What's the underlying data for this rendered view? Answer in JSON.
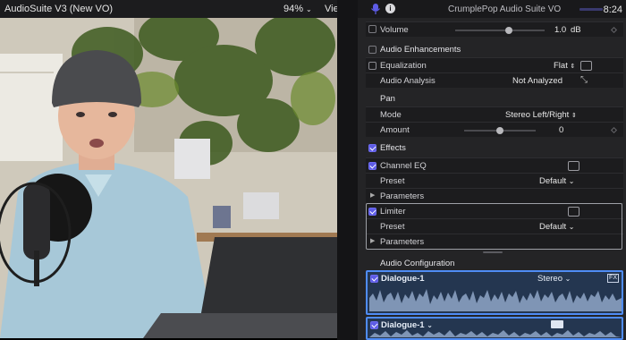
{
  "viewer": {
    "title": "AudioSuite V3 (New VO)",
    "zoom": "94%",
    "view_label": "View"
  },
  "inspector": {
    "title": "CrumplePop Audio Suite VO",
    "timecode": "8:24",
    "volume": {
      "label": "Volume",
      "value": "1.0",
      "unit": "dB",
      "slider_level": 0.8
    },
    "audio_enhancements": {
      "header": "Audio Enhancements",
      "equalization": {
        "label": "Equalization",
        "value": "Flat"
      },
      "analysis": {
        "label": "Audio Analysis",
        "value": "Not Analyzed"
      }
    },
    "pan": {
      "header": "Pan",
      "mode": {
        "label": "Mode",
        "value": "Stereo Left/Right"
      },
      "amount": {
        "label": "Amount",
        "value": "0",
        "slider_level": 0.5
      }
    },
    "effects": {
      "header": "Effects",
      "channel_eq": {
        "label": "Channel EQ",
        "preset_label": "Preset",
        "preset_value": "Default",
        "parameters_label": "Parameters"
      },
      "limiter": {
        "label": "Limiter",
        "preset_label": "Preset",
        "preset_value": "Default",
        "parameters_label": "Parameters"
      }
    },
    "audio_configuration": {
      "header": "Audio Configuration",
      "roles": [
        {
          "name": "Dialogue-1",
          "channel": "Stereo"
        },
        {
          "name": "Dialogue-1"
        }
      ]
    }
  },
  "colors": {
    "accent": "#5e5ce6",
    "role_blue": "#4f8cf5",
    "panel": "#242426"
  }
}
